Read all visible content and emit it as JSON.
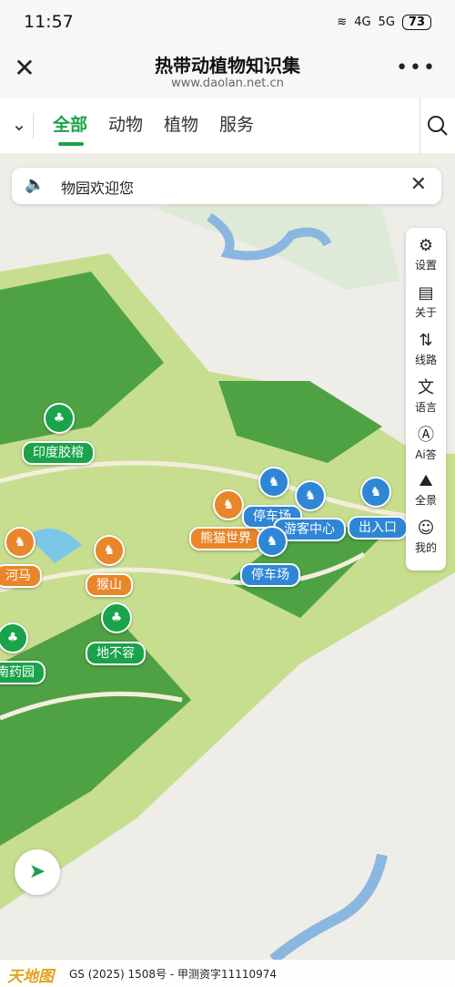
{
  "status": {
    "time": "11:57",
    "battery": "73",
    "signal1": "4G",
    "signal2": "5G"
  },
  "header": {
    "title": "热带动植物知识集",
    "url": "www.daolan.net.cn"
  },
  "tabs": [
    "全部",
    "动物",
    "植物",
    "服务"
  ],
  "notice": {
    "text": "物园欢迎您"
  },
  "tools": [
    {
      "icon": "gear-icon",
      "label": "设置"
    },
    {
      "icon": "document-icon",
      "label": "关于"
    },
    {
      "icon": "route-icon",
      "label": "线路"
    },
    {
      "icon": "translate-icon",
      "label": "语言"
    },
    {
      "icon": "ai-icon",
      "label": "Ai答"
    },
    {
      "icon": "panorama-icon",
      "label": "全景"
    },
    {
      "icon": "person-icon",
      "label": "我的"
    }
  ],
  "map_labels": {
    "indian_rubber": "印度胶榕",
    "hippo": "河马",
    "monkey_hill": "猴山",
    "dibu_rong": "地不容",
    "medicine_garden": "南药园",
    "panda_world": "熊猫世界",
    "parking1": "停车场",
    "parking2": "停车场",
    "visitor_center": "游客中心",
    "entrance": "出入口"
  },
  "footer": {
    "logo": "天地图",
    "copyright": "GS (2025) 1508号 - 甲测资字11110974"
  },
  "colors": {
    "accent": "#1aa34a",
    "animal": "#e9862a",
    "service": "#2f86d6"
  }
}
